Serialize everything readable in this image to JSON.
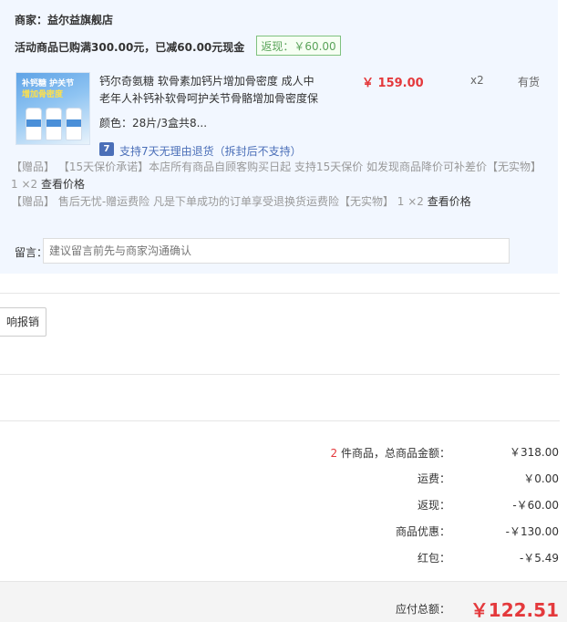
{
  "seller": {
    "label": "商家：益尔益旗舰店"
  },
  "promotion": {
    "text": "活动商品已购满300.00元，已减60.00元现金",
    "rebate_badge": "返现：￥60.00"
  },
  "product": {
    "thumbnail": {
      "line1": "补钙糖 护关节",
      "line2": "增加骨密度"
    },
    "title_line1": "钙尔奇氨糖 软骨素加钙片增加骨密度 成人中",
    "title_line2": "老年人补钙补软骨呵护关节骨骼增加骨密度保",
    "price": "￥ 159.00",
    "quantity": "x2",
    "stock": "有货",
    "spec": "颜色：28片/3盒共8...",
    "return_policy": {
      "icon": "7",
      "text": "支持7天无理由退货（拆封后不支持）"
    }
  },
  "gifts": [
    {
      "tag": "【赠品】",
      "text": "【15天保价承诺】本店所有商品自顾客购买日起 支持15天保价 如发现商品降价可补差价【无实物】 1 ×2",
      "link": "查看价格"
    },
    {
      "tag": "【赠品】",
      "text": "售后无忧-赠运费险 凡是下单成功的订单享受退换货运费险【无实物】 1 ×2",
      "link": "查看价格"
    }
  ],
  "note": {
    "label": "留言：",
    "placeholder": "建议留言前先与商家沟通确认"
  },
  "invoice_button": {
    "label": "响报销"
  },
  "summary": {
    "count": "2",
    "count_label": "件商品，总商品金额：",
    "rows": [
      {
        "value": "￥318.00"
      },
      {
        "label": "运费：",
        "value": "￥0.00"
      },
      {
        "label": "返现：",
        "value": "-￥60.00"
      },
      {
        "label": "商品优惠：",
        "value": "-￥130.00"
      },
      {
        "label": "红包：",
        "value": "-￥5.49"
      }
    ],
    "total_label": "应付总额：",
    "total_value": "￥122.51"
  },
  "colors": {
    "accent_red": "#e4393c",
    "link_blue": "#4b6fb8",
    "badge_green": "#5aa35a",
    "panel_bg": "#f2f7ff"
  }
}
